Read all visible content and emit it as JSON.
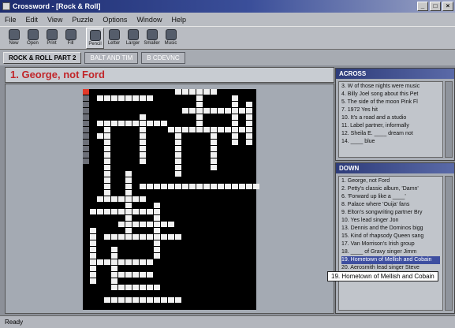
{
  "window": {
    "title": "Crossword - [Rock & Roll]"
  },
  "menu": [
    "File",
    "Edit",
    "View",
    "Puzzle",
    "Options",
    "Window",
    "Help"
  ],
  "toolbar": [
    {
      "label": "New",
      "icon": "new-icon"
    },
    {
      "label": "Open",
      "icon": "open-icon"
    },
    {
      "label": "Print",
      "icon": "print-icon"
    },
    {
      "label": "Fill",
      "icon": "fill-icon"
    },
    {
      "label": "Pencil",
      "icon": "pencil-icon",
      "active": true
    },
    {
      "label": "Letter",
      "icon": "letter-icon"
    },
    {
      "label": "Larger",
      "icon": "zoom-in-icon"
    },
    {
      "label": "Smaller",
      "icon": "zoom-out-icon"
    },
    {
      "label": "Music",
      "icon": "music-icon"
    }
  ],
  "tabs": [
    {
      "label": "ROCK & ROLL PART 2",
      "active": true
    },
    {
      "label": "BALT AND TIM",
      "active": false
    },
    {
      "label": "B CDEVNC",
      "active": false
    }
  ],
  "current_clue": "1. George, not Ford",
  "across": {
    "title": "ACROSS",
    "clues": [
      "3. W of those nights were music",
      "4. Billy Joel song about this Pet",
      "5. The side of the moon Pink Fl",
      "7. 1972 Yes hit",
      "10. It's a road and a studio",
      "11. Label partner, informally",
      "12. Sheila E. ____ dream not",
      "14. ____ blue"
    ]
  },
  "down": {
    "title": "DOWN",
    "clues": [
      "1. George, not Ford",
      "2. Petty's classic album, 'Damn'",
      "6. 'Forward up like a ____'",
      "8. Palace where 'Ouija' fans",
      "9. Elton's songwriting partner Bry",
      "10. Yes lead singer Jon",
      "13. Dennis and the Dominos bigg",
      "15. Kind of rhapsody Queen sang",
      "17. Van Morrison's Irish group",
      "18. ____ of Gravy singer Jimm",
      "19. Hometown of Mellish and Cobain",
      "20. Aerosmith lead singer Steve"
    ],
    "highlighted_index": 10
  },
  "tooltip": "19. Hometown of Mellish and Cobain",
  "status": "Ready"
}
